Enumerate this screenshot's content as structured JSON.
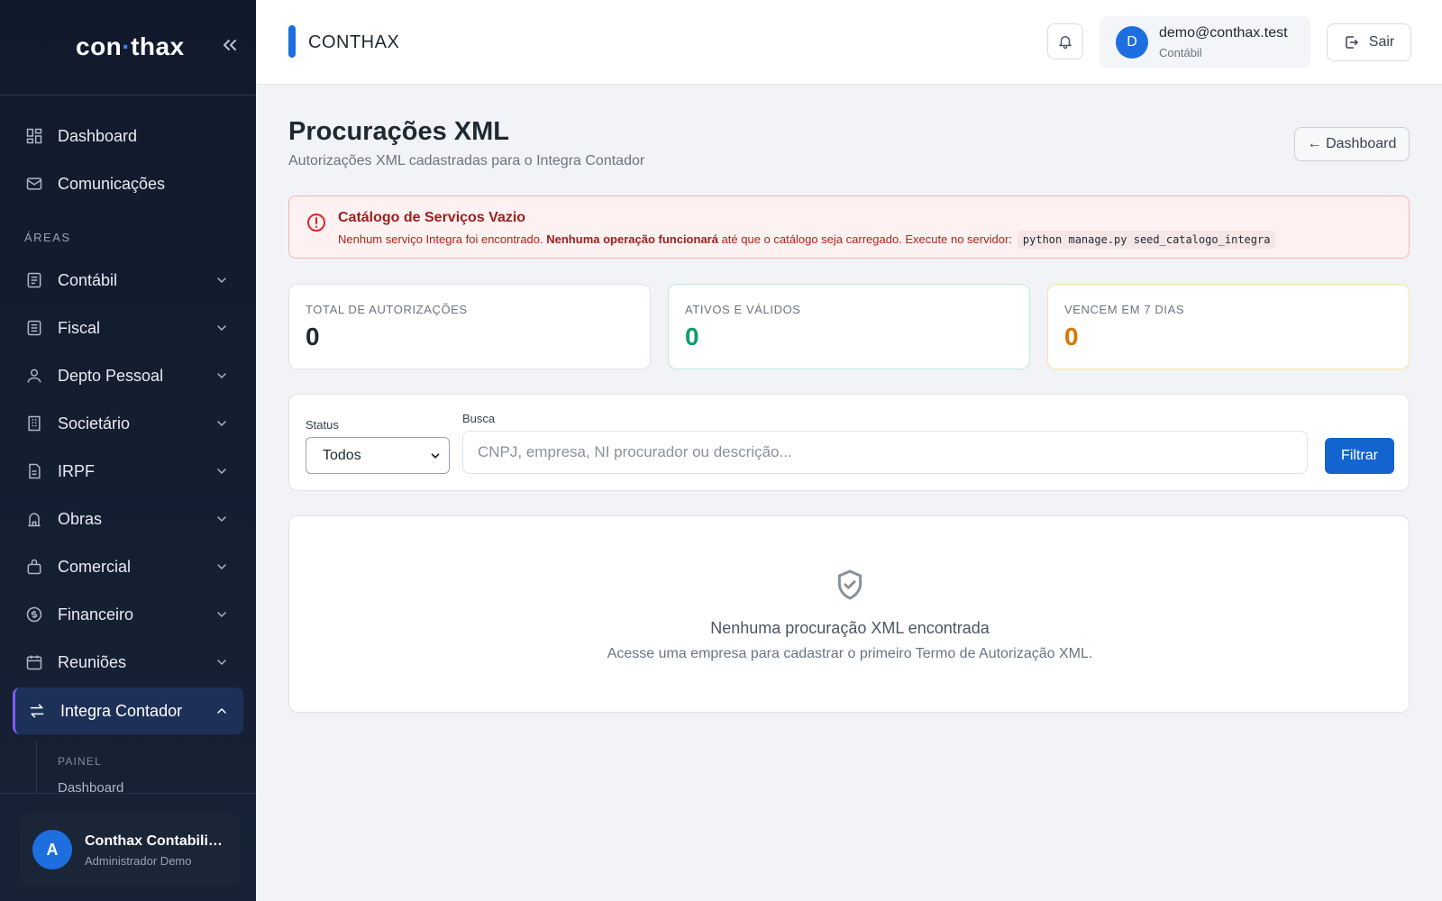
{
  "sidebar": {
    "logo": {
      "left": "con",
      "dot": "·",
      "right": "thax"
    },
    "items_top": [
      {
        "label": "Dashboard",
        "icon": "dashboard-icon"
      },
      {
        "label": "Comunicações",
        "icon": "mail-icon"
      }
    ],
    "section_label": "ÁREAS",
    "areas": [
      {
        "label": "Contábil",
        "icon": "ledger-icon"
      },
      {
        "label": "Fiscal",
        "icon": "receipt-icon"
      },
      {
        "label": "Depto Pessoal",
        "icon": "person-icon"
      },
      {
        "label": "Societário",
        "icon": "building-icon"
      },
      {
        "label": "IRPF",
        "icon": "document-icon"
      },
      {
        "label": "Obras",
        "icon": "construction-icon"
      },
      {
        "label": "Comercial",
        "icon": "bag-icon"
      },
      {
        "label": "Financeiro",
        "icon": "coin-icon"
      },
      {
        "label": "Reuniões",
        "icon": "calendar-icon"
      },
      {
        "label": "Integra Contador",
        "icon": "arrows-exchange-icon",
        "active": true
      }
    ],
    "submenu": {
      "label": "PAINEL",
      "item": "Dashboard"
    },
    "user": {
      "initial": "A",
      "name": "Conthax Contabilidade",
      "role": "Administrador Demo"
    },
    "active_accent": "#7c5cf5"
  },
  "topbar": {
    "app_title": "CONTHAX",
    "account": {
      "initial": "D",
      "email": "demo@conthax.test",
      "role": "Contábil"
    },
    "logout_label": "Sair"
  },
  "page": {
    "title": "Procurações XML",
    "subtitle": "Autorizações XML cadastradas para o Integra Contador",
    "back_label": "← Dashboard"
  },
  "alert": {
    "title": "Catálogo de Serviços Vazio",
    "text_1": "Nenhum serviço Integra foi encontrado. ",
    "text_bold": "Nenhuma operação funcionará",
    "text_2": " até que o catálogo seja carregado. Execute no servidor:",
    "command": "python manage.py seed_catalogo_integra",
    "color": "#dc2626"
  },
  "stats": [
    {
      "label": "TOTAL DE AUTORIZAÇÕES",
      "value": "0",
      "color": "#1f2933",
      "border": "#dfe3e9"
    },
    {
      "label": "ATIVOS E VÁLIDOS",
      "value": "0",
      "color": "#0f9d6e",
      "border": "#bfeadb"
    },
    {
      "label": "VENCEM EM 7 DIAS",
      "value": "0",
      "color": "#d97706",
      "border": "#f6e3a8"
    }
  ],
  "filters": {
    "status_label": "Status",
    "status_value": "Todos",
    "search_label": "Busca",
    "search_placeholder": "CNPJ, empresa, NI procurador ou descrição...",
    "search_value": "",
    "submit_label": "Filtrar",
    "button_color": "#1464d0"
  },
  "empty_state": {
    "icon": "shield-check-icon",
    "title": "Nenhuma procuração XML encontrada",
    "text": "Acesse uma empresa para cadastrar o primeiro Termo de Autorização XML."
  }
}
